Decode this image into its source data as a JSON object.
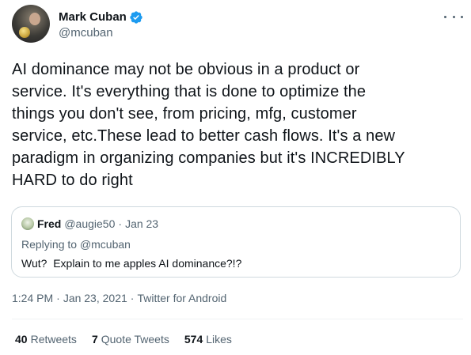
{
  "author": {
    "name": "Mark Cuban",
    "handle": "@mcuban"
  },
  "tweet": {
    "lines": [
      "AI dominance may not be obvious in a product or",
      "service. It's everything that is done to optimize the",
      "things you don't see, from pricing, mfg, customer",
      "service, etc.These lead to better cash flows. It's a new",
      "paradigm in organizing companies but it's INCREDIBLY",
      "HARD to do right"
    ]
  },
  "quote": {
    "name": "Fred",
    "handle": "@augie50",
    "separator": "·",
    "date": "Jan 23",
    "replying_prefix": "Replying to",
    "replying_to": "@mcuban",
    "text": "Wut?  Explain to me apples AI dominance?!?"
  },
  "meta": {
    "time": "1:24 PM",
    "date": "Jan 23, 2021",
    "source": "Twitter for Android",
    "separator": "·"
  },
  "stats": [
    {
      "count": "40",
      "label": "Retweets"
    },
    {
      "count": "7",
      "label": "Quote Tweets"
    },
    {
      "count": "574",
      "label": "Likes"
    }
  ],
  "icons": {
    "verified": "verified-badge-icon",
    "more": "more-options-icon"
  },
  "colors": {
    "verified": "#1d9bf0",
    "text": "#0f1419",
    "secondary": "#536471",
    "border": "#cfd9de"
  }
}
